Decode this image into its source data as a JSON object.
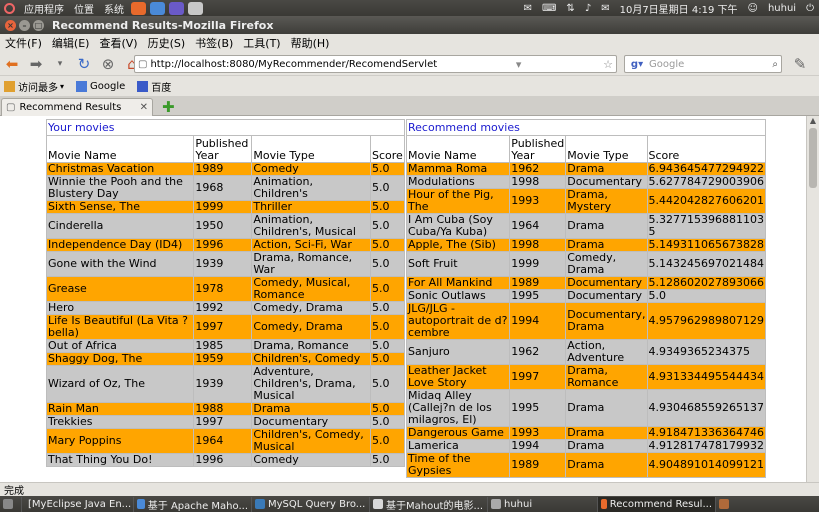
{
  "top_panel": {
    "apps": "应用程序",
    "places": "位置",
    "system": "系统",
    "datetime": "10月7日星期日 4:19 下午",
    "user": "huhui"
  },
  "window": {
    "title": "Recommend Results-Mozilla Firefox"
  },
  "menu": [
    "文件(F)",
    "编辑(E)",
    "查看(V)",
    "历史(S)",
    "书签(B)",
    "工具(T)",
    "帮助(H)"
  ],
  "address": {
    "url": "http://localhost:8080/MyRecommender/RecomendServlet",
    "search_placeholder": "Google"
  },
  "bookmarks": [
    "访问最多",
    "Google",
    "百度"
  ],
  "tab": {
    "label": "Recommend Results"
  },
  "left_table": {
    "title": "Your movies",
    "headers": [
      "Movie Name",
      "Published Year",
      "Movie Type",
      "Score"
    ],
    "rows": [
      [
        "Christmas Vacation",
        "1989",
        "Comedy",
        "5.0"
      ],
      [
        "Winnie the Pooh and the Blustery Day",
        "1968",
        "Animation, Children's",
        "5.0"
      ],
      [
        "Sixth Sense, The",
        "1999",
        "Thriller",
        "5.0"
      ],
      [
        "Cinderella",
        "1950",
        "Animation, Children's, Musical",
        "5.0"
      ],
      [
        "Independence Day (ID4)",
        "1996",
        "Action, Sci-Fi, War",
        "5.0"
      ],
      [
        "Gone with the Wind",
        "1939",
        "Drama, Romance, War",
        "5.0"
      ],
      [
        "Grease",
        "1978",
        "Comedy, Musical, Romance",
        "5.0"
      ],
      [
        "Hero",
        "1992",
        "Comedy, Drama",
        "5.0"
      ],
      [
        "Life Is Beautiful (La Vita ? bella)",
        "1997",
        "Comedy, Drama",
        "5.0"
      ],
      [
        "Out of Africa",
        "1985",
        "Drama, Romance",
        "5.0"
      ],
      [
        "Shaggy Dog, The",
        "1959",
        "Children's, Comedy",
        "5.0"
      ],
      [
        "Wizard of Oz, The",
        "1939",
        "Adventure, Children's, Drama, Musical",
        "5.0"
      ],
      [
        "Rain Man",
        "1988",
        "Drama",
        "5.0"
      ],
      [
        "Trekkies",
        "1997",
        "Documentary",
        "5.0"
      ],
      [
        "Mary Poppins",
        "1964",
        "Children's, Comedy, Musical",
        "5.0"
      ],
      [
        "That Thing You Do!",
        "1996",
        "Comedy",
        "5.0"
      ]
    ]
  },
  "right_table": {
    "title": "Recommend movies",
    "headers": [
      "Movie Name",
      "Published Year",
      "Movie Type",
      "Score"
    ],
    "rows": [
      [
        "Mamma Roma",
        "1962",
        "Drama",
        "6.943645477294922"
      ],
      [
        "Modulations",
        "1998",
        "Documentary",
        "5.627784729003906"
      ],
      [
        "Hour of the Pig, The",
        "1993",
        "Drama, Mystery",
        "5.442042827606201"
      ],
      [
        "I Am Cuba (Soy Cuba/Ya Kuba)",
        "1964",
        "Drama",
        "5.327715396881103​5"
      ],
      [
        "Apple, The (Sib)",
        "1998",
        "Drama",
        "5.149311065673828"
      ],
      [
        "Soft Fruit",
        "1999",
        "Comedy, Drama",
        "5.143245697021484"
      ],
      [
        "For All Mankind",
        "1989",
        "Documentary",
        "5.128602027893066"
      ],
      [
        "Sonic Outlaws",
        "1995",
        "Documentary",
        "5.0"
      ],
      [
        "JLG/JLG - autoportrait de d?cembre",
        "1994",
        "Documentary, Drama",
        "4.957962989807129"
      ],
      [
        "Sanjuro",
        "1962",
        "Action, Adventure",
        "4.9349365234375"
      ],
      [
        "Leather Jacket Love Story",
        "1997",
        "Drama, Romance",
        "4.931334495544434"
      ],
      [
        "Midaq Alley (Callej?n de los milagros, El)",
        "1995",
        "Drama",
        "4.930468559265137"
      ],
      [
        "Dangerous Game",
        "1993",
        "Drama",
        "4.918471336364746"
      ],
      [
        "Lamerica",
        "1994",
        "Drama",
        "4.912817478179932"
      ],
      [
        "Time of the Gypsies",
        "1989",
        "Drama",
        "4.904891014099121"
      ]
    ]
  },
  "status": {
    "text": "完成"
  },
  "taskbar": [
    "[MyEclipse Java En...",
    "基于 Apache Maho...",
    "MySQL Query Bro...",
    "基于Mahout的电影...",
    "huhui",
    "Recommend Resul..."
  ],
  "colors": {
    "row_orange": "#ffa500",
    "row_gray": "#c8c8c8",
    "link_blue": "#1a1acf"
  }
}
